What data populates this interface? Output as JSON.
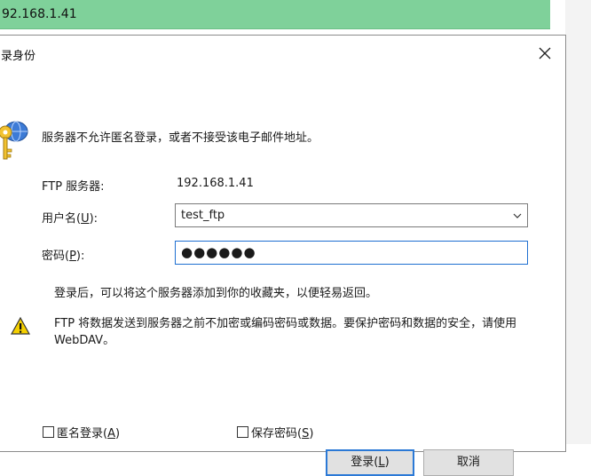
{
  "address_bar": {
    "text": "92.168.1.41"
  },
  "dialog": {
    "title": "录身份",
    "message": "服务器不允许匿名登录，或者不接受该电子邮件地址。",
    "ftp_server_label": "FTP 服务器:",
    "ftp_server_value": "192.168.1.41",
    "username_label": "用户名(",
    "username_accel": "U",
    "username_label_end": "):",
    "username_value": "test_ftp",
    "password_label": "密码(",
    "password_accel": "P",
    "password_label_end": "):",
    "password_value": "●●●●●●",
    "info": "登录后，可以将这个服务器添加到你的收藏夹，以便轻易返回。",
    "warning": "FTP 将数据发送到服务器之前不加密或编码密码或数据。要保护密码和数据的安全，请使用 WebDAV。",
    "anon_label": "匿名登录(",
    "anon_accel": "A",
    "anon_end": ")",
    "save_label": "保存密码(",
    "save_accel": "S",
    "save_end": ")",
    "login_label": "登录(",
    "login_accel": "L",
    "login_end": ")",
    "cancel_label": "取消"
  },
  "icons": {
    "close": "close-icon",
    "key": "key-icon",
    "warning": "warning-icon",
    "dropdown": "chevron-down-icon"
  },
  "colors": {
    "address_bar": "#7fd19a",
    "focus_border": "#2b79d6",
    "button_bg": "#e1e1e1"
  }
}
